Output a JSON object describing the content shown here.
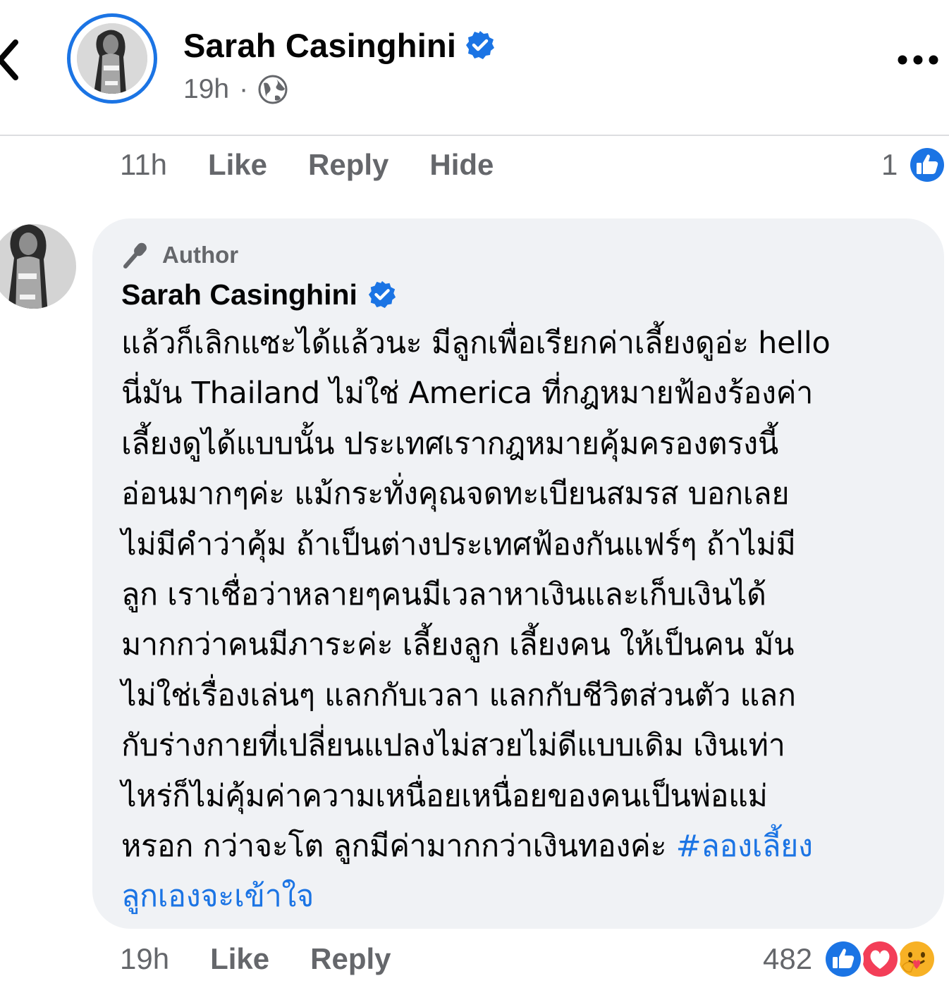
{
  "header": {
    "author_name": "Sarah Casinghini",
    "post_time": "19h",
    "separator": "·",
    "verified_icon": "verified-badge-icon",
    "privacy_icon": "globe-icon"
  },
  "reply_actions_top": {
    "time": "11h",
    "like_label": "Like",
    "reply_label": "Reply",
    "hide_label": "Hide",
    "like_count": "1"
  },
  "comment": {
    "badge_label": "Author",
    "author_name": "Sarah Casinghini",
    "lines": [
      "แล้วก็เลิกแซะได้แล้วนะ มีลูกเพื่อเรียกค่าเลี้ยงดูอ่ะ hello",
      "นี่มัน Thailand ไม่ใช่ America ที่กฎหมายฟ้องร้องค่า",
      "เลี้ยงดูได้แบบนั้น ประเทศเรากฎหมายคุ้มครองตรงนี้",
      "อ่อนมากๆค่ะ แม้กระทั่งคุณจดทะเบียนสมรส บอกเลย",
      "ไม่มีคำว่าคุ้ม ถ้าเป็นต่างประเทศฟ้องกันแฟร์ๆ ถ้าไม่มี",
      "ลูก เราเชื่อว่าหลายๆคนมีเวลาหาเงินและเก็บเงินได้",
      "มากกว่าคนมีภาระค่ะ เลี้ยงลูก เลี้ยงคน ให้เป็นคน มัน",
      "ไม่ใช่เรื่องเล่นๆ แลกกับเวลา แลกกับชีวิตส่วนตัว แลก",
      "กับร่างกายที่เปลี่ยนแปลงไม่สวยไม่ดีแบบเดิม เงินเท่า",
      "ไหร่ก็ไม่คุ้มค่าความเหนื่อยเหนื่อยของคนเป็นพ่อแม่",
      "หรอก กว่าจะโต ลูกมีค่ามากกว่าเงินทองค่ะ"
    ],
    "hashtag_part1": "#ลองเลี้ยง",
    "hashtag_part2": "ลูกเองจะเข้าใจ"
  },
  "comment_actions": {
    "time": "19h",
    "like_label": "Like",
    "reply_label": "Reply",
    "reaction_count": "482",
    "reaction_icons": [
      "like-reaction-icon",
      "love-reaction-icon",
      "care-reaction-icon"
    ]
  },
  "colors": {
    "accent_blue": "#1b74e4",
    "secondary_text": "#65676b",
    "bubble_bg": "#f0f2f5",
    "love_red": "#f33e58",
    "care_yellow": "#f7b125"
  }
}
